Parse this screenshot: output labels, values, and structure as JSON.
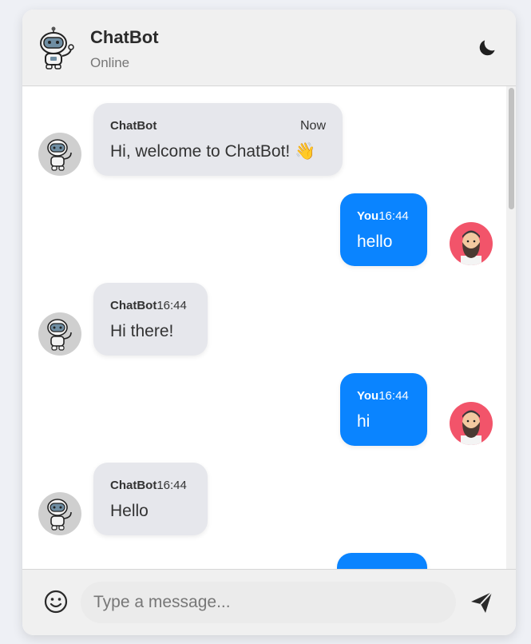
{
  "header": {
    "title": "ChatBot",
    "status": "Online",
    "theme_icon": "moon-icon"
  },
  "messages": [
    {
      "sender": "ChatBot",
      "time": "Now",
      "text": "Hi, welcome to ChatBot! 👋",
      "from": "bot"
    },
    {
      "sender": "You",
      "time": "16:44",
      "text": "hello",
      "from": "user"
    },
    {
      "sender": "ChatBot",
      "time": "16:44",
      "text": "Hi there!",
      "from": "bot"
    },
    {
      "sender": "You",
      "time": "16:44",
      "text": "hi",
      "from": "user"
    },
    {
      "sender": "ChatBot",
      "time": "16:44",
      "text": "Hello",
      "from": "bot"
    }
  ],
  "composer": {
    "placeholder": "Type a message...",
    "value": "",
    "emoji_icon": "smiley-icon",
    "send_icon": "send-icon"
  },
  "colors": {
    "user_bubble": "#0a84ff",
    "bot_bubble": "#e6e7ec",
    "header_bg": "#f0f0f0"
  }
}
